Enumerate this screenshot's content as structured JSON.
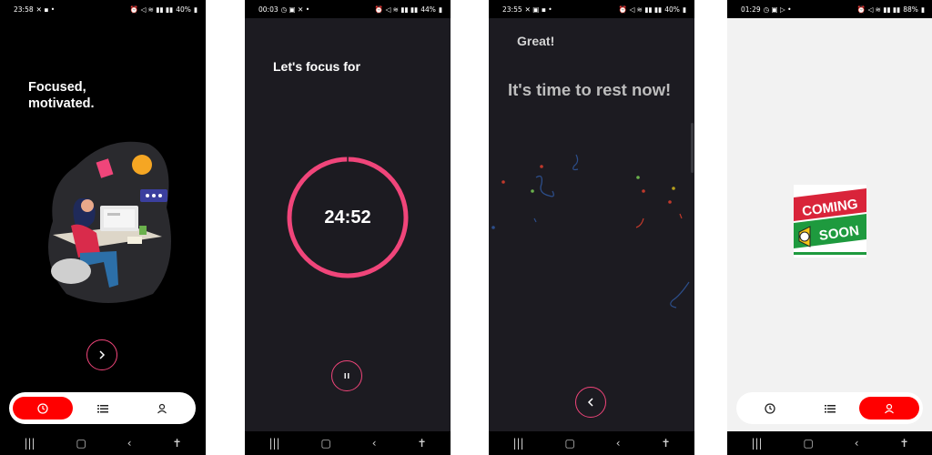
{
  "screens": [
    {
      "id": "onboarding",
      "status": {
        "time": "23:58",
        "battery": "40%"
      },
      "headline": "Focused,\nmotivated.",
      "next_icon": "chevron-right-icon",
      "tabs": [
        {
          "icon": "clock-icon",
          "active": true
        },
        {
          "icon": "list-icon",
          "active": false
        },
        {
          "icon": "person-icon",
          "active": false
        }
      ]
    },
    {
      "id": "focus-timer",
      "status": {
        "time": "00:03",
        "battery": "44%"
      },
      "title": "Let's focus for",
      "timer": "24:52",
      "pause_icon": "pause-icon"
    },
    {
      "id": "break",
      "status": {
        "time": "23:55",
        "battery": "40%"
      },
      "great": "Great!",
      "message": "It's time to rest now!",
      "back_icon": "chevron-left-icon"
    },
    {
      "id": "profile",
      "status": {
        "time": "01:29",
        "battery": "88%"
      },
      "coming_soon": {
        "line1": "COMING",
        "line2": "SOON"
      },
      "tabs": [
        {
          "icon": "clock-icon",
          "active": false
        },
        {
          "icon": "list-icon",
          "active": false
        },
        {
          "icon": "person-icon",
          "active": true
        }
      ]
    }
  ],
  "colors": {
    "accent_pink": "#f0457a",
    "tab_active_red": "#ff0000",
    "dark_bg": "#1c1b21"
  },
  "navbar_icons": [
    "recents-icon",
    "home-icon",
    "back-icon",
    "accessibility-icon"
  ]
}
